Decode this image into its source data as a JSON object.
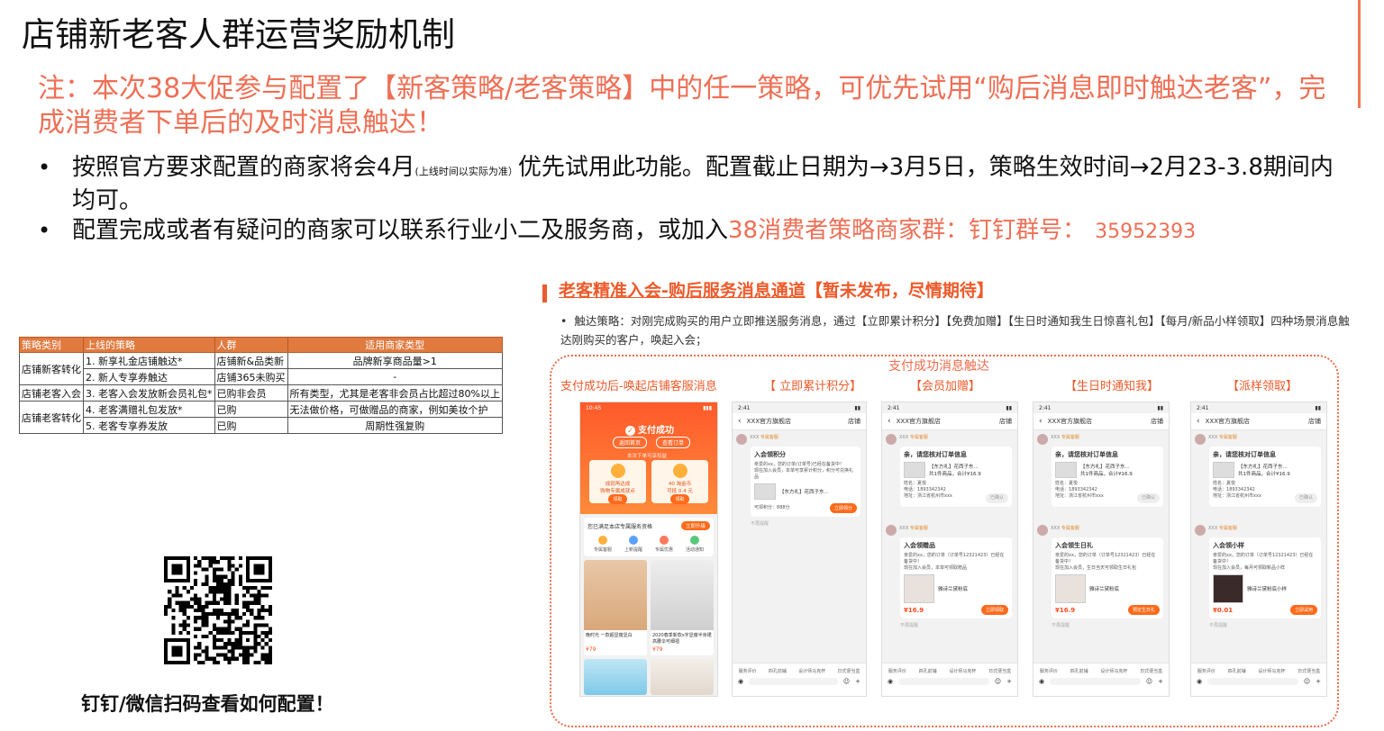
{
  "header": {
    "title": "店铺新老客人群运营奖励机制",
    "note": "注：本次38大促参与配置了【新客策略/老客策略】中的任一策略，可优先试用“购后消息即时触达老客”，完成消费者下单后的及时消息触达！",
    "bullet1_a": "按照官方要求配置的商家将会4月",
    "bullet1_small": "(上线时间以实际为准）",
    "bullet1_b": "优先试用此功能。配置截止日期为→3月5日，策略生效时间→2月23-3.8期间内均可。",
    "bullet2_a": "配置完成或者有疑问的商家可以联系行业小二及服务商，或加入",
    "bullet2_hl": "38消费者策略商家群：钉钉群号：",
    "bullet2_num": "35952393",
    "bullet_glyph": "•"
  },
  "table": {
    "headers": [
      "策略类别",
      "上线的策略",
      "人群",
      "适用商家类型"
    ],
    "rows": [
      [
        "1. 新享礼金店铺触达*",
        "店铺新&品类新",
        "品牌新享商品量>1"
      ],
      [
        "2. 新人专享券触达",
        "店铺365未购买",
        "-"
      ],
      [
        "3. 老客入会发放新会员礼包*",
        "已购非会员",
        "所有类型，尤其是老客非会员占比超过80%以上"
      ],
      [
        "4. 老客满赠礼包发放*",
        "已购",
        "无法做价格，可做赠品的商家，例如美妆个护"
      ],
      [
        "5. 老客专享券发放",
        "已购",
        "周期性强复购"
      ]
    ],
    "categories": [
      "店铺新客转化",
      "店铺老客入会",
      "店铺老客转化"
    ]
  },
  "qr": {
    "caption": "钉钉/微信扫码查看如何配置！"
  },
  "panel": {
    "section_title_u": "老客精准入会-购后服务消息通道",
    "section_title_rest": "【暂未发布，尽情期待】",
    "tactic": "触达策略：对刚完成购买的用户立即推送服务消息，通过【立即累计积分】【免费加赠】【生日时通知我生日惊喜礼包】【每月/新品小样领取】四种场景消息触达刚购买的客户，唤起入会；",
    "pay_trigger_label": "支付成功消息触达",
    "phone_labels": [
      "支付成功后-唤起店铺客服消息",
      "【 立即累计积分】",
      "【会员加赠】",
      "【生日时通知我】",
      "【派样领取】"
    ]
  },
  "phone_pay": {
    "time": "10:45",
    "title": "支付成功",
    "btn_home": "返回首页",
    "btn_order": "查看订单",
    "sub": "本次下单可享权益",
    "box1_a": "成就再达成",
    "box1_b": "购物专属成就点",
    "box1_btn": "领取",
    "box2_a": "40 淘金币",
    "box2_b": "可抵 0.4 元",
    "box2_btn": "领取",
    "svc_title": "您已满足本店专属服务资格",
    "svc_pill": "立即升级",
    "icons": [
      "专属客服",
      "上新提醒",
      "专属优惠",
      "活动通知"
    ],
    "items": [
      {
        "cap": "晚时光 一款超显瘦显白",
        "price": "¥79"
      },
      {
        "cap": "2020春季新款ⅹ字显瘦半身裙高腰伞可细褶",
        "price": "¥79"
      }
    ]
  },
  "phone_common": {
    "time": "2:41",
    "store": "XXX官方旗舰店",
    "store_link": "店铺",
    "tag": "专属客服",
    "tabs": [
      "服务评价",
      "四孔前辅",
      "设计师马克杯",
      "日式便当盒"
    ],
    "not_remind": "不再提醒"
  },
  "phone_points": {
    "card_title": "入会领积分",
    "lines": [
      "亲爱的xx，您的订单(订单号)已经在备货中！",
      "现在加入会员，本单可享累计积分，积分可兑换礼品"
    ],
    "product": "【东方礼】花西子东...",
    "points_label": "可领积分：",
    "points_val": "888分",
    "btn": "立即领分"
  },
  "phone_confirm": {
    "title": "亲，请您核对订单信息",
    "product": "【东方礼】花西子东...",
    "sub": "共1件商品，合计¥16.9",
    "name_label": "姓名：",
    "name": "夏悦",
    "phone_label": "电话：",
    "phone": "1893342342",
    "addr_label": "地址：",
    "addr": "浙江省杭州市xxx",
    "btn": "已确认"
  },
  "phone_gift": {
    "title": "入会领赠品",
    "lines": [
      "亲爱的xx，您的订单（订单号12321423）已经在备货中！",
      "现在加入会员，本单可领取赠品"
    ],
    "product": "雅诗兰黛粉底",
    "price": "¥16.9",
    "btn": "立即领取"
  },
  "phone_bday": {
    "title": "入会领生日礼",
    "lines": [
      "亲爱的xx，您的订单（订单号12321423）已经在备货中！",
      "现在加入会员，生日当天可领取生日礼包"
    ],
    "product": "雅诗兰黛粉底",
    "price": "¥16.9",
    "btn": "预定生日礼"
  },
  "phone_sample": {
    "title": "入会领小样",
    "lines": [
      "亲爱的xx，您的订单（订单号12321423）已经在备货中！",
      "现在加入会员，每月可领取新品小样"
    ],
    "product": "雅诗兰黛粉底小样",
    "price": "¥0.01",
    "btn": "立即试用"
  }
}
